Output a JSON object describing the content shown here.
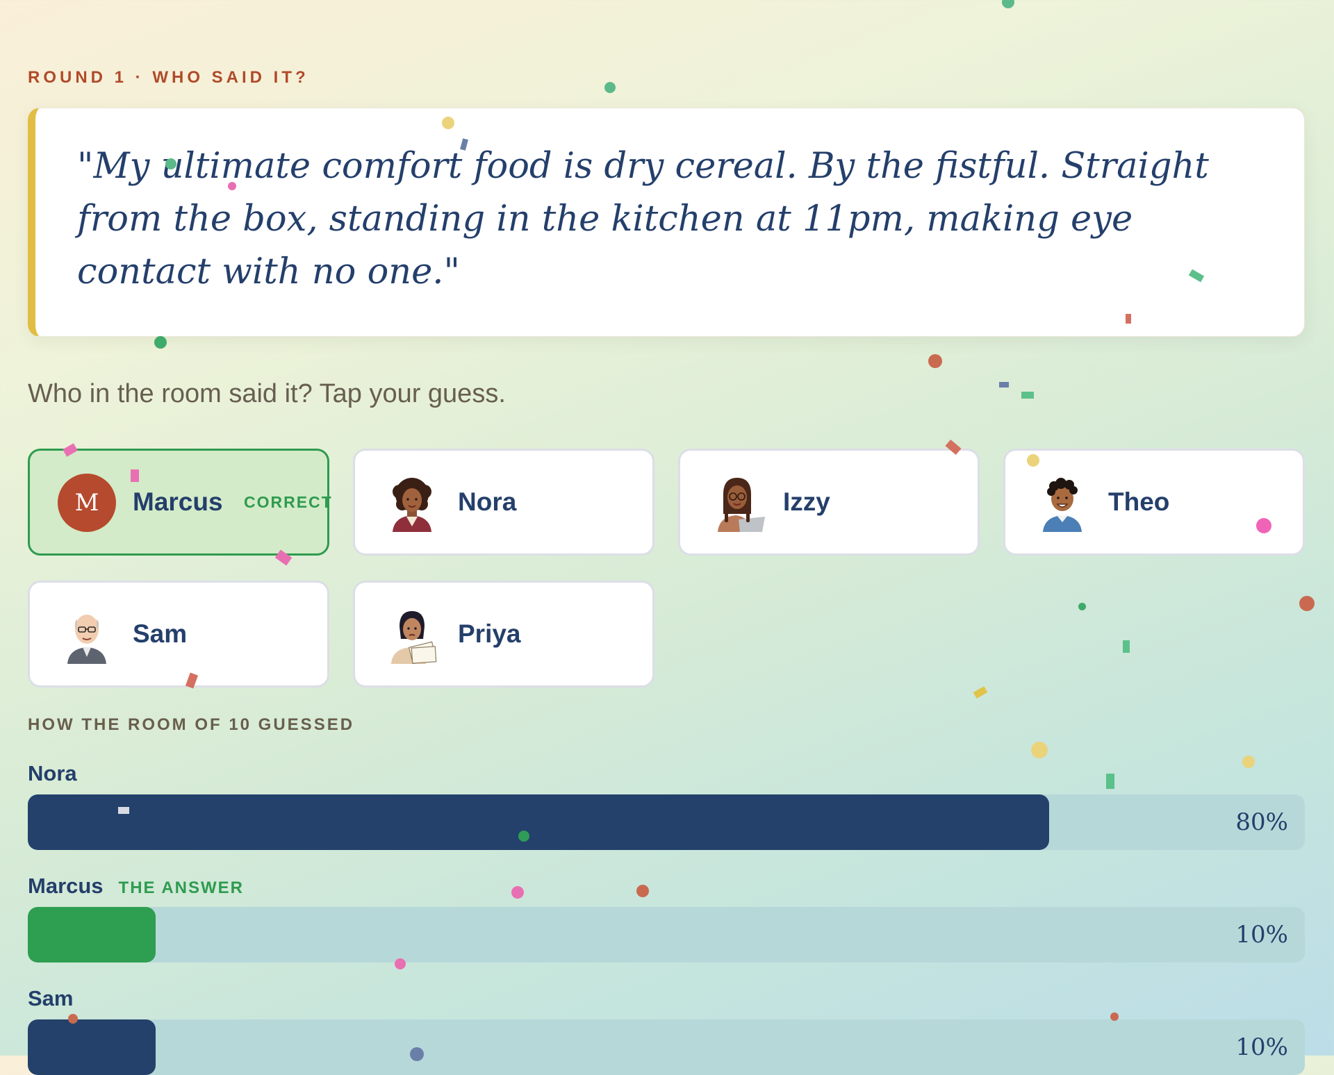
{
  "round_label": "ROUND 1 · WHO SAID IT?",
  "quote": "\"My ultimate comfort food is dry cereal. By the fistful. Straight from the box, standing in the kitchen at 11pm, making eye contact with no one.\"",
  "prompt": "Who in the room said it? Tap your guess.",
  "options": [
    {
      "name": "Marcus",
      "avatar": "monogram",
      "initial": "M",
      "tag": "CORRECT",
      "state": "correct"
    },
    {
      "name": "Nora",
      "avatar": "woman-curly-hair-icon"
    },
    {
      "name": "Izzy",
      "avatar": "woman-braids-glasses-icon"
    },
    {
      "name": "Theo",
      "avatar": "man-curly-hair-icon"
    },
    {
      "name": "Sam",
      "avatar": "older-man-glasses-icon"
    },
    {
      "name": "Priya",
      "avatar": "woman-holding-papers-icon"
    }
  ],
  "results": {
    "label": "HOW THE ROOM OF 10 GUESSED",
    "rows": [
      {
        "name": "Nora",
        "pct": 80,
        "pct_label": "80%",
        "color": "#23416b"
      },
      {
        "name": "Marcus",
        "tag": "THE ANSWER",
        "pct": 10,
        "pct_label": "10%",
        "color": "#2e9e50"
      },
      {
        "name": "Sam",
        "pct": 10,
        "pct_label": "10%",
        "color": "#23416b"
      }
    ]
  },
  "colors": {
    "accent_gold": "#e2bd45",
    "navy": "#243f6b",
    "correct_green": "#2e9b4f",
    "round_red": "#b04a2a"
  }
}
